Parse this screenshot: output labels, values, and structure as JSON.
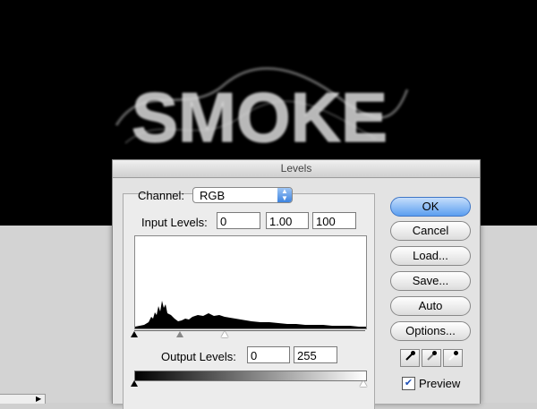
{
  "canvas": {
    "artwork_text": "SMOKE"
  },
  "dialog": {
    "title": "Levels",
    "channel_label": "Channel:",
    "channel_value": "RGB",
    "input_levels_label": "Input Levels:",
    "input_levels": [
      "0",
      "1.00",
      "100"
    ],
    "output_levels_label": "Output Levels:",
    "output_levels": [
      "0",
      "255"
    ],
    "buttons": {
      "ok": "OK",
      "cancel": "Cancel",
      "load": "Load...",
      "save": "Save...",
      "auto": "Auto",
      "options": "Options..."
    },
    "preview_label": "Preview",
    "preview_checked": true,
    "eyedroppers": [
      "black-eyedropper-icon",
      "gray-eyedropper-icon",
      "white-eyedropper-icon"
    ],
    "accent_color": "#5b9ef0"
  }
}
